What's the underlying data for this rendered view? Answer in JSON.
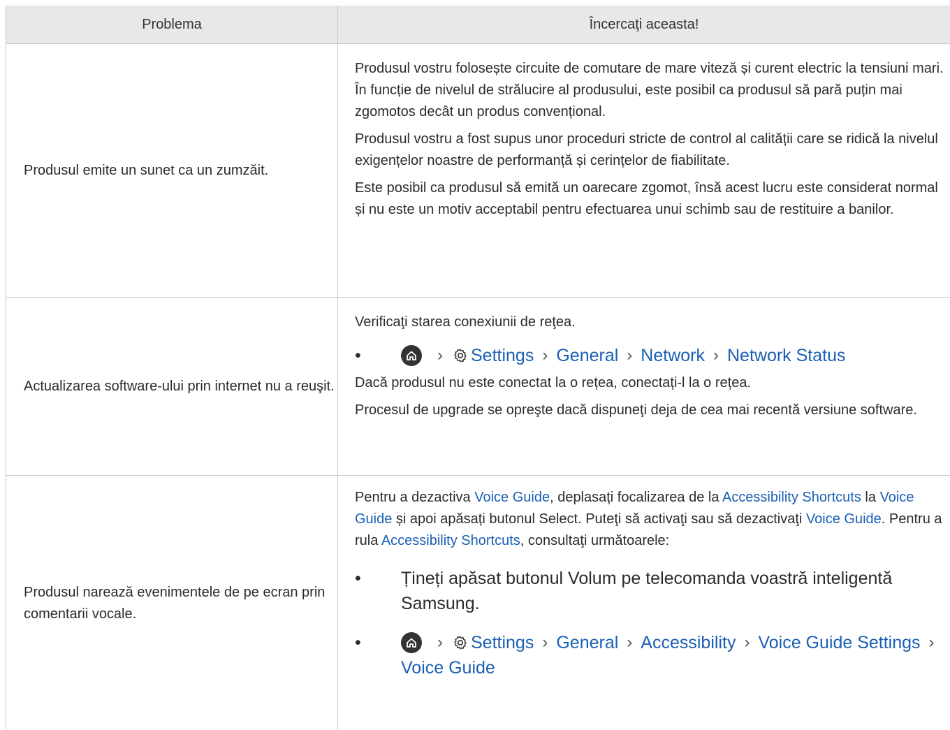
{
  "header": {
    "col1": "Problema",
    "col2": "Încercaţi aceasta!"
  },
  "rows": [
    {
      "problem": "Produsul emite un sunet ca un zumzăit.",
      "paragraphs": [
        "Produsul vostru folosește circuite de comutare de mare viteză și curent electric la tensiuni mari. În funcție de nivelul de strălucire al produsului, este posibil ca produsul să pară puțin mai zgomotos decât un produs convențional.",
        "Produsul vostru a fost supus unor proceduri stricte de control al calității care se ridică la nivelul exigențelor noastre de performanță și cerințelor de fiabilitate.",
        "Este posibil ca produsul să emită un oarecare zgomot, însă acest lucru este considerat normal și nu este un motiv acceptabil pentru efectuarea unui schimb sau de restituire a banilor."
      ]
    },
    {
      "problem": "Actualizarea software-ului prin internet nu a reuşit.",
      "intro": "Verificaţi starea conexiunii de reţea.",
      "path": [
        "Settings",
        "General",
        "Network",
        "Network Status"
      ],
      "after1": "Dacă produsul nu este conectat la o rețea, conectați-l la o rețea.",
      "after2": "Procesul de upgrade se opreşte dacă dispuneţi deja de cea mai recentă versiune software."
    },
    {
      "problem": "Produsul narează evenimentele de pe ecran prin comentarii vocale.",
      "p1": {
        "t1": "Pentru a dezactiva ",
        "l1": "Voice Guide",
        "t2": ", deplasați focalizarea de la ",
        "l2": "Accessibility Shortcuts",
        "t3": " la ",
        "l3": "Voice Guide",
        "t4": " și apoi apăsați butonul Select. Puteţi să activaţi sau să dezactivaţi ",
        "l4": "Voice Guide",
        "t5": ". Pentru a rula ",
        "l5": "Accessibility Shortcuts",
        "t6": ", consultaţi următoarele:"
      },
      "bullet1": "Țineți apăsat butonul Volum pe telecomanda voastră inteligentă Samsung.",
      "path": [
        "Settings",
        "General",
        "Accessibility",
        "Voice Guide Settings",
        "Voice Guide"
      ]
    }
  ],
  "icons": {
    "home": "home-icon",
    "settings": "gear-icon",
    "separator": "chevron-right-icon"
  },
  "colors": {
    "link": "#1a5fb4",
    "header_bg": "#e8e8e8"
  }
}
